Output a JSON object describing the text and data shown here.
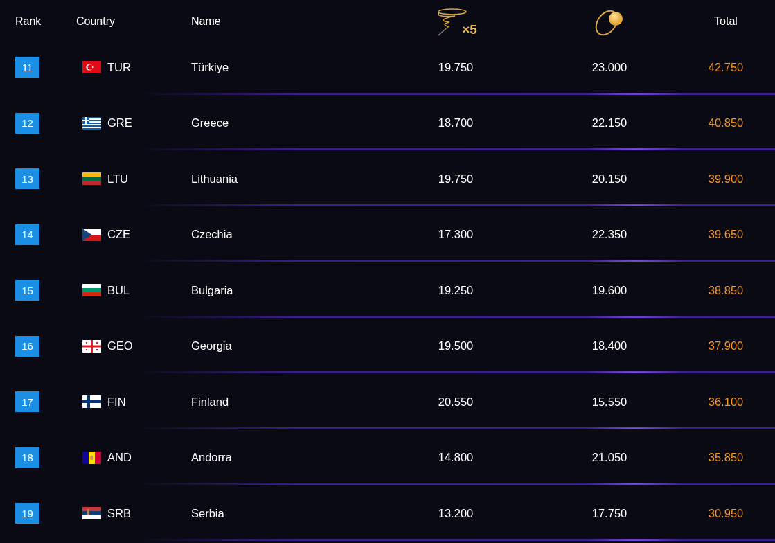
{
  "header": {
    "rank": "Rank",
    "country": "Country",
    "name": "Name",
    "column_4": {
      "multiplier": "×5"
    },
    "total": "Total"
  },
  "rows": [
    {
      "rank": "11",
      "kind": "tr",
      "code": "TUR",
      "name": "Türkiye",
      "column_4": "19.750",
      "column_5": "23.000",
      "total": "42.750"
    },
    {
      "rank": "12",
      "kind": "gr",
      "code": "GRE",
      "name": "Greece",
      "column_4": "18.700",
      "column_5": "22.150",
      "total": "40.850"
    },
    {
      "rank": "13",
      "kind": "lt",
      "code": "LTU",
      "name": "Lithuania",
      "column_4": "19.750",
      "column_5": "20.150",
      "total": "39.900"
    },
    {
      "rank": "14",
      "kind": "cz",
      "code": "CZE",
      "name": "Czechia",
      "column_4": "17.300",
      "column_5": "22.350",
      "total": "39.650"
    },
    {
      "rank": "15",
      "kind": "bg",
      "code": "BUL",
      "name": "Bulgaria",
      "column_4": "19.250",
      "column_5": "19.600",
      "total": "38.850"
    },
    {
      "rank": "16",
      "kind": "ge",
      "code": "GEO",
      "name": "Georgia",
      "column_4": "19.500",
      "column_5": "18.400",
      "total": "37.900"
    },
    {
      "rank": "17",
      "kind": "fi",
      "code": "FIN",
      "name": "Finland",
      "column_4": "20.550",
      "column_5": "15.550",
      "total": "36.100"
    },
    {
      "rank": "18",
      "kind": "ad",
      "code": "AND",
      "name": "Andorra",
      "column_4": "14.800",
      "column_5": "21.050",
      "total": "35.850"
    },
    {
      "rank": "19",
      "kind": "rs",
      "code": "SRB",
      "name": "Serbia",
      "column_4": "13.200",
      "column_5": "17.750",
      "total": "30.950"
    }
  ]
}
